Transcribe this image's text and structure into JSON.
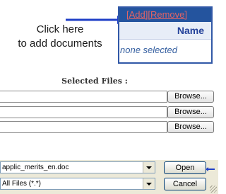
{
  "hint": {
    "line1": "Click here",
    "line2": "to add documents"
  },
  "panel": {
    "add_label": "[Add]",
    "remove_label": "[Remove]",
    "column_header": "Name",
    "empty_text": "none selected"
  },
  "selected_files": {
    "title": "Selected Files :",
    "rows": [
      {
        "value": "",
        "browse_label": "Browse..."
      },
      {
        "value": "",
        "browse_label": "Browse..."
      },
      {
        "value": "",
        "browse_label": "Browse..."
      }
    ]
  },
  "file_dialog": {
    "file_name": "applic_merits_en.doc",
    "file_type": "All Files (*.*)",
    "open_label": "Open",
    "cancel_label": "Cancel"
  },
  "colors": {
    "arrow": "#1f3fc7",
    "arrow_tip": "#e03030",
    "panel_header": "#24549e",
    "panel_links": "#e26464"
  }
}
